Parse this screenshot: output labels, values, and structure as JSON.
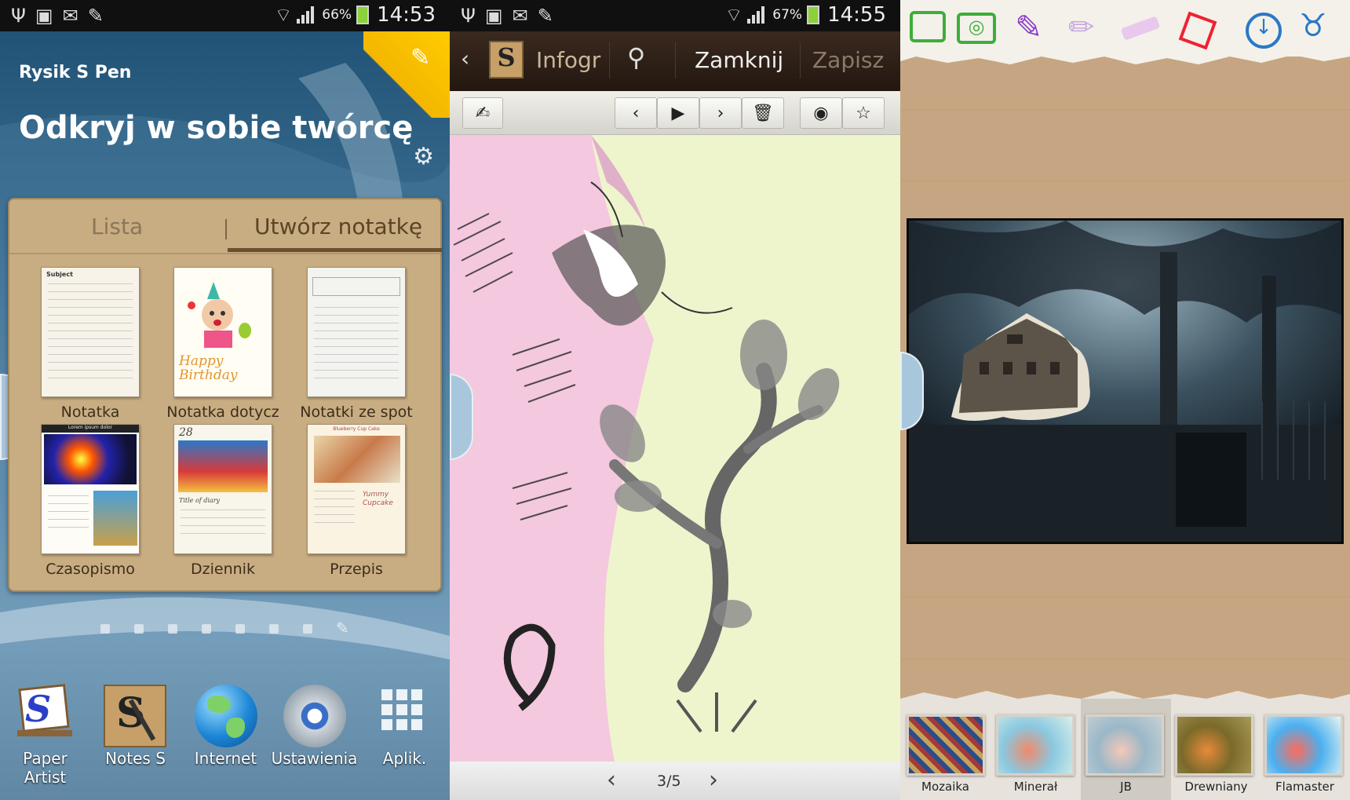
{
  "screen1": {
    "status": {
      "battery_pct": "66%",
      "time": "14:53"
    },
    "widget_subtitle": "Rysik S Pen",
    "widget_title": "Odkryj w sobie twórcę",
    "tabs": [
      {
        "label": "Lista"
      },
      {
        "label": "Utwórz notatkę",
        "active": true
      }
    ],
    "templates": [
      {
        "label": "Notatka"
      },
      {
        "label": "Notatka dotycz"
      },
      {
        "label": "Notatki ze spot"
      },
      {
        "label": "Czasopismo"
      },
      {
        "label": "Dziennik"
      },
      {
        "label": "Przepis"
      }
    ],
    "template_texts": {
      "subject": "Subject",
      "birthday": "Happy Birthday",
      "diary_day": "28",
      "diary_title": "Title of diary",
      "magazine_head": "Lorem ipsum dolor",
      "recipe_head": "Blueberry Cup Cake",
      "cupcake": "Yummy Cupcake"
    },
    "page_dots": 7,
    "dock": [
      {
        "label": "Paper Artist",
        "icon": "paper-artist-icon"
      },
      {
        "label": "Notes S",
        "icon": "notes-s-icon"
      },
      {
        "label": "Internet",
        "icon": "globe-icon"
      },
      {
        "label": "Ustawienia",
        "icon": "settings-icon"
      },
      {
        "label": "Aplik.",
        "icon": "apps-grid-icon"
      }
    ]
  },
  "screen2": {
    "status": {
      "battery_pct": "67%",
      "time": "14:55"
    },
    "doc_title": "Infogra",
    "close_label": "Zamknij",
    "save_label": "Zapisz",
    "page_indicator": "3/5",
    "app_icon_letter": "S"
  },
  "screen3": {
    "filters": [
      {
        "label": "Mozaika"
      },
      {
        "label": "Minerał"
      },
      {
        "label": "JB"
      },
      {
        "label": "Drewniany"
      },
      {
        "label": "Flamaster"
      }
    ]
  },
  "colors": {
    "accent_yellow": "#f3b700",
    "widget_bg": "#c9ad82",
    "canvas_green": "#eef5cd",
    "canvas_pink": "#f4c8de"
  }
}
